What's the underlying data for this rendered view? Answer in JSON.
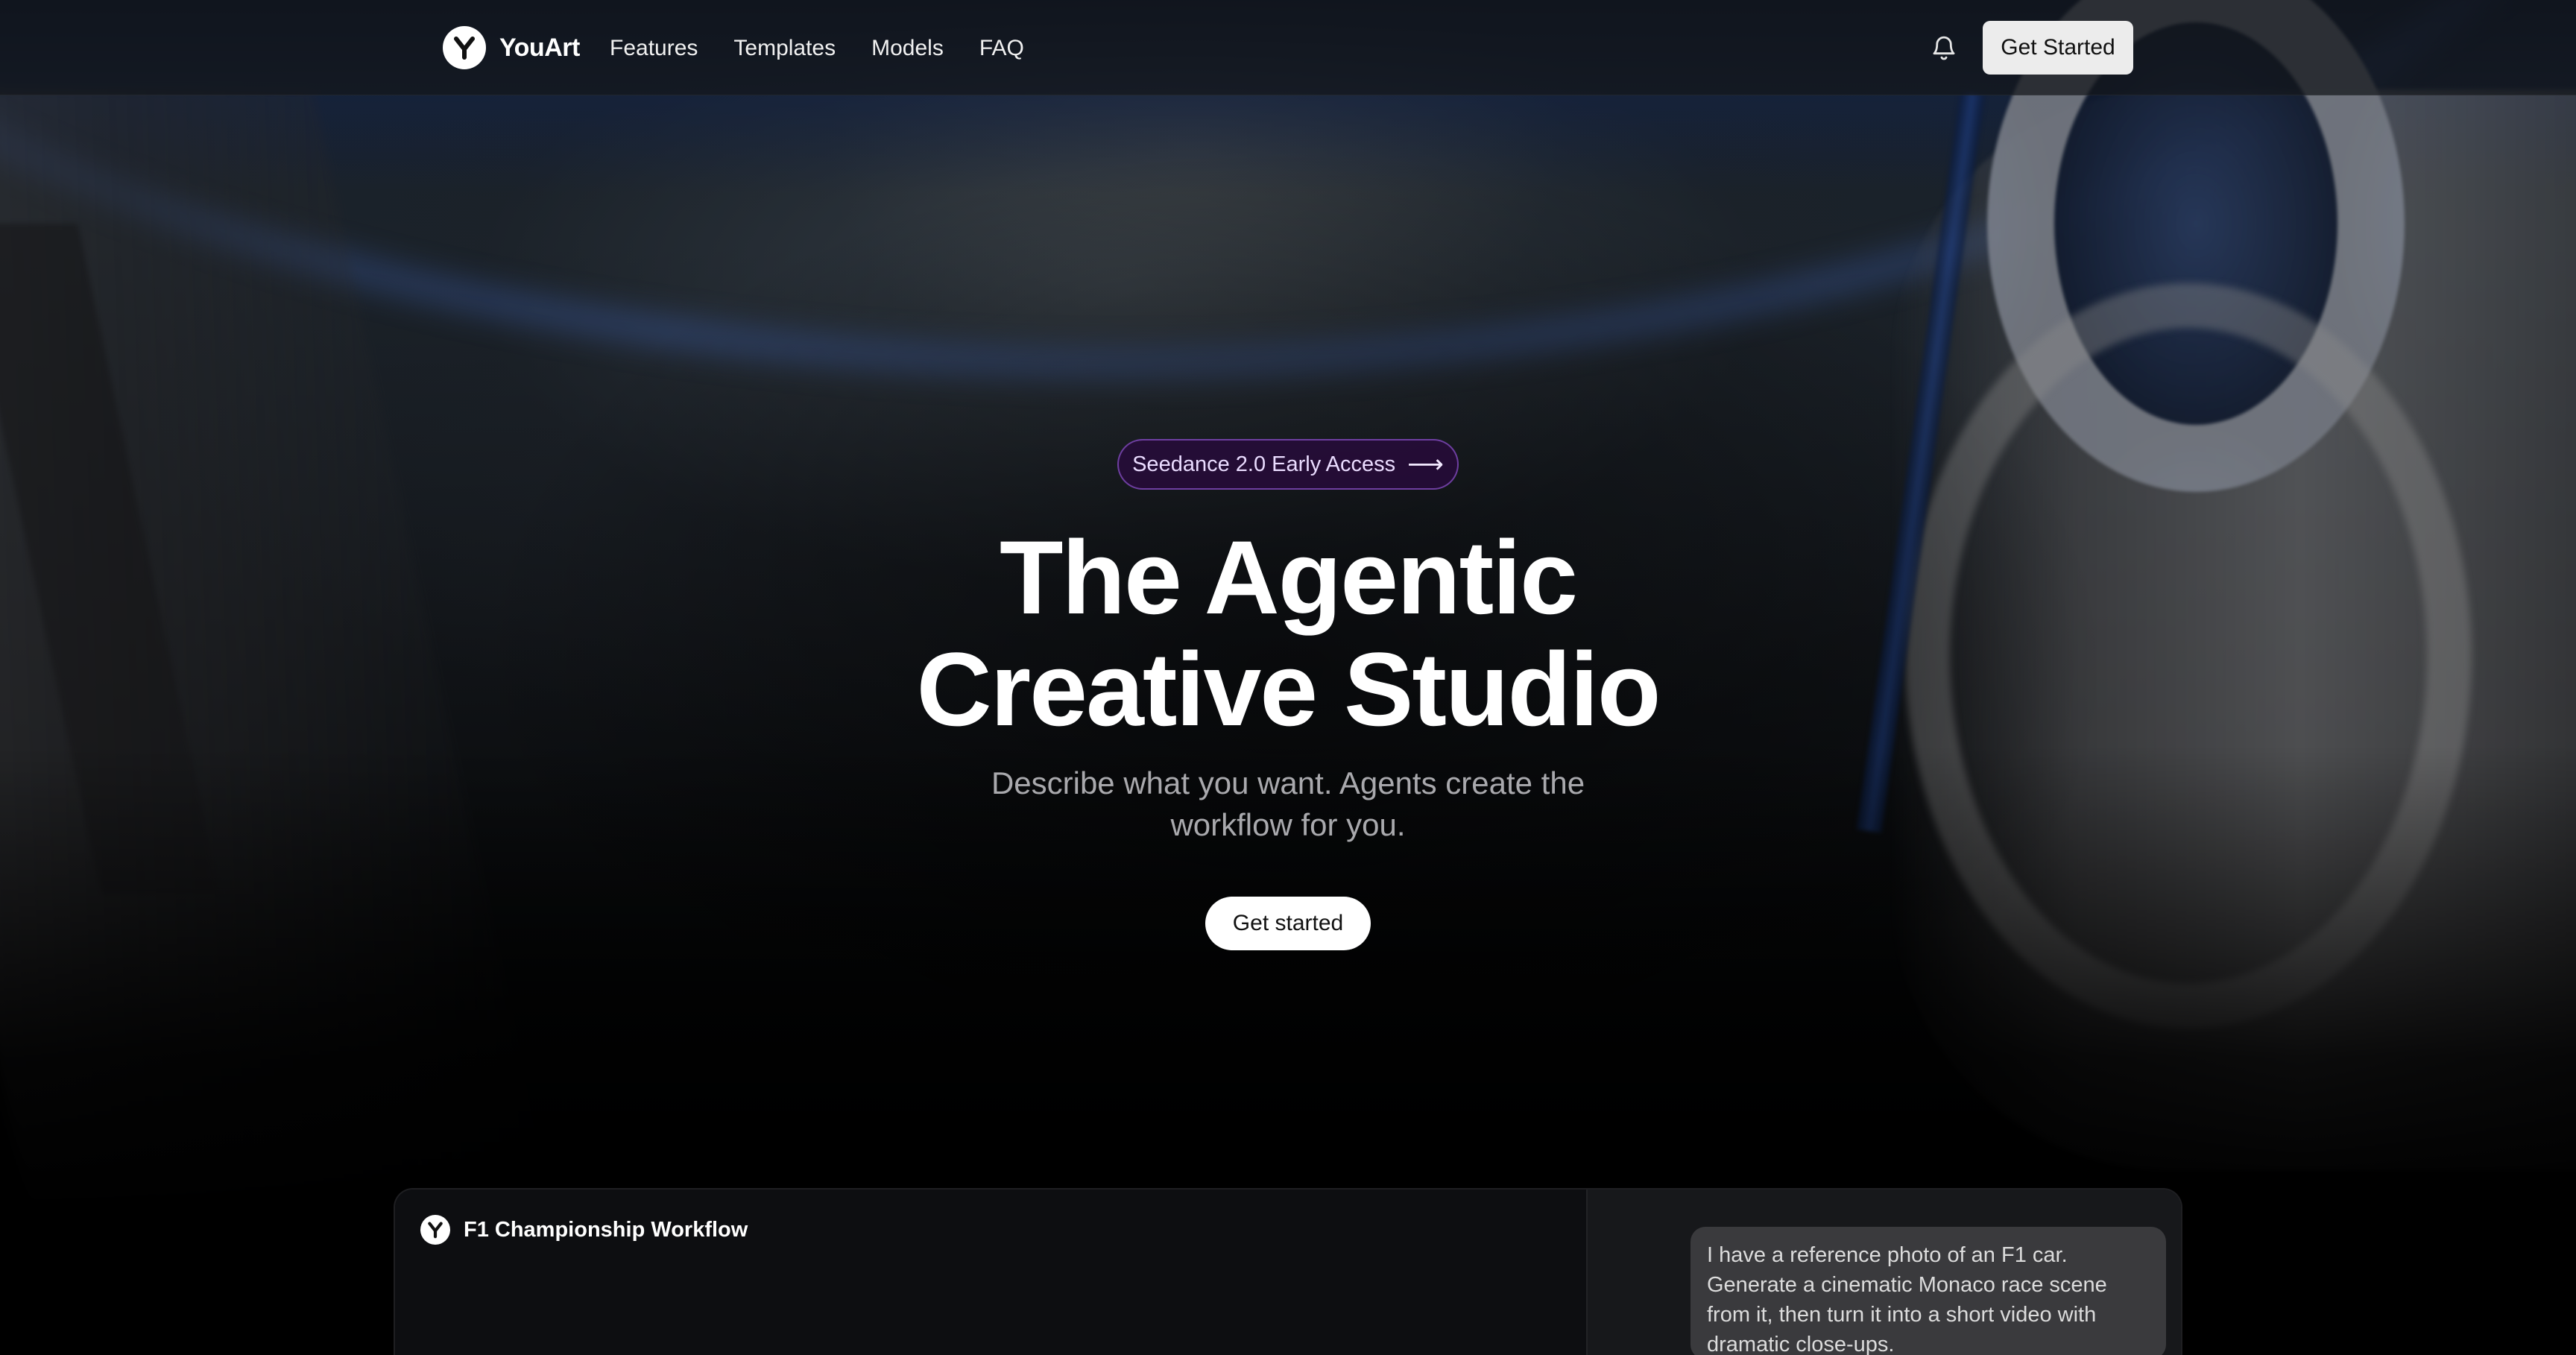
{
  "brand": {
    "name": "YouArt"
  },
  "nav": {
    "items": [
      {
        "label": "Features"
      },
      {
        "label": "Templates"
      },
      {
        "label": "Models"
      },
      {
        "label": "FAQ"
      }
    ],
    "cta_label": "Get Started"
  },
  "hero": {
    "badge_label": "Seedance 2.0 Early Access",
    "headline_line1": "The Agentic",
    "headline_line2": "Creative Studio",
    "subhead": "Describe what you want. Agents create the workflow for you.",
    "cta_label": "Get started"
  },
  "workflow": {
    "title": "F1 Championship Workflow",
    "chat_message": "I have a reference photo of an F1 car. Generate a cinematic Monaco race scene from it, then turn it into a short video with dramatic close-ups."
  },
  "icons": {
    "logo": "youart-logo-icon",
    "notifications": "bell-icon",
    "badge_arrow": "arrow-right-icon"
  },
  "colors": {
    "badge_bg": "#280a3c",
    "badge_border": "#965adc",
    "cta_bg": "#ffffff",
    "nav_cta_bg": "#ececec"
  }
}
